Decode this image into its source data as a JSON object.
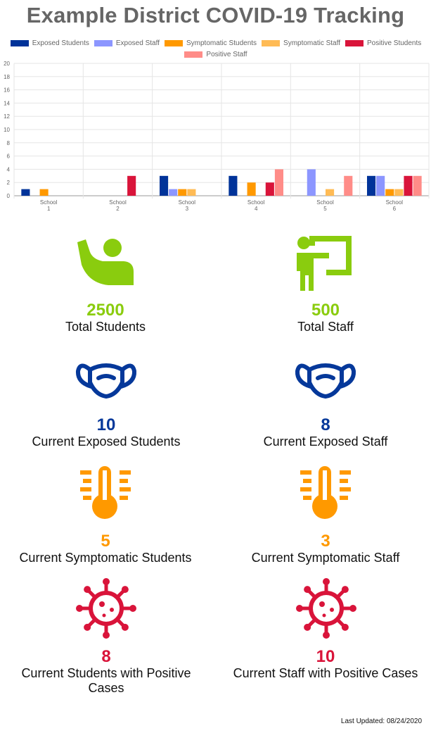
{
  "page": {
    "title": "Example District COVID-19 Tracking",
    "last_updated": "Last Updated: 08/24/2020"
  },
  "colors": {
    "green": "#8ACC0E",
    "blue": "#05389A",
    "orange": "#FF9900",
    "red": "#D9143A"
  },
  "chart_data": {
    "type": "bar",
    "categories": [
      [
        "School",
        "1"
      ],
      [
        "School",
        "2"
      ],
      [
        "School",
        "3"
      ],
      [
        "School",
        "4"
      ],
      [
        "School",
        "5"
      ],
      [
        "School",
        "6"
      ]
    ],
    "series": [
      {
        "name": "Exposed Students",
        "color": "#003399",
        "values": [
          1,
          0,
          3,
          3,
          0,
          3
        ]
      },
      {
        "name": "Exposed Staff",
        "color": "#8C96FF",
        "values": [
          0,
          0,
          1,
          0,
          4,
          3
        ]
      },
      {
        "name": "Symptomatic Students",
        "color": "#FF9900",
        "values": [
          1,
          0,
          1,
          2,
          0,
          1
        ]
      },
      {
        "name": "Symptomatic Staff",
        "color": "#FFBB55",
        "values": [
          0,
          0,
          1,
          0,
          1,
          1
        ]
      },
      {
        "name": "Positive Students",
        "color": "#D9143A",
        "values": [
          0,
          3,
          0,
          2,
          0,
          3
        ]
      },
      {
        "name": "Positive Staff",
        "color": "#FF8C88",
        "values": [
          0,
          0,
          0,
          4,
          3,
          3
        ]
      }
    ],
    "ylim": [
      0,
      20
    ],
    "yticks": [
      0,
      2,
      4,
      6,
      8,
      10,
      12,
      14,
      16,
      18,
      20
    ],
    "grid": true,
    "legend": "top"
  },
  "stats": {
    "total_students": {
      "value": "2500",
      "label": "Total Students",
      "icon": "student-raising-hand-icon"
    },
    "total_staff": {
      "value": "500",
      "label": "Total Staff",
      "icon": "teacher-at-board-icon"
    },
    "exposed_students": {
      "value": "10",
      "label": "Current Exposed Students",
      "icon": "face-mask-icon"
    },
    "exposed_staff": {
      "value": "8",
      "label": "Current Exposed Staff",
      "icon": "face-mask-icon"
    },
    "symptomatic_students": {
      "value": "5",
      "label": "Current Symptomatic Students",
      "icon": "thermometer-icon"
    },
    "symptomatic_staff": {
      "value": "3",
      "label": "Current Symptomatic Staff",
      "icon": "thermometer-icon"
    },
    "positive_students": {
      "value": "8",
      "label_line1": "Current Students with Positive",
      "label_line2": "Cases",
      "icon": "virus-icon"
    },
    "positive_staff": {
      "value": "10",
      "label": "Current Staff with Positive Cases",
      "icon": "virus-icon"
    }
  }
}
